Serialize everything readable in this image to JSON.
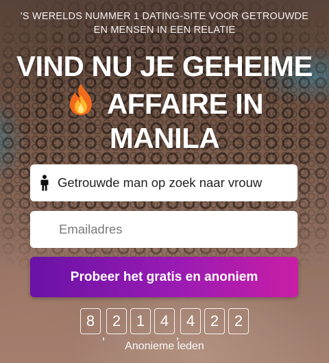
{
  "hero": {
    "tagline_line1": "'S WERELDS NUMMER 1 DATING-SITE VOOR GETROUWDE",
    "tagline_line2": "EN MENSEN IN EEN RELATIE",
    "headline_line1": "VIND NU JE GEHEIME",
    "headline_line2": "AFFAIRE IN",
    "headline_line3": "MANILA",
    "headline_icon": "fire-emoji"
  },
  "form": {
    "status_value": "Getrouwde man op zoek naar vrouw",
    "status_icon": "person-icon",
    "email_placeholder": "Emailadres",
    "submit_label": "Probeer het gratis en anoniem",
    "button_gradient": [
      "#6a12a6",
      "#c81ea5"
    ]
  },
  "counter": {
    "digits": [
      "8",
      "2",
      "1",
      "4",
      "4",
      "2",
      "2"
    ],
    "separator": ",",
    "label": "Anonieme leden"
  }
}
